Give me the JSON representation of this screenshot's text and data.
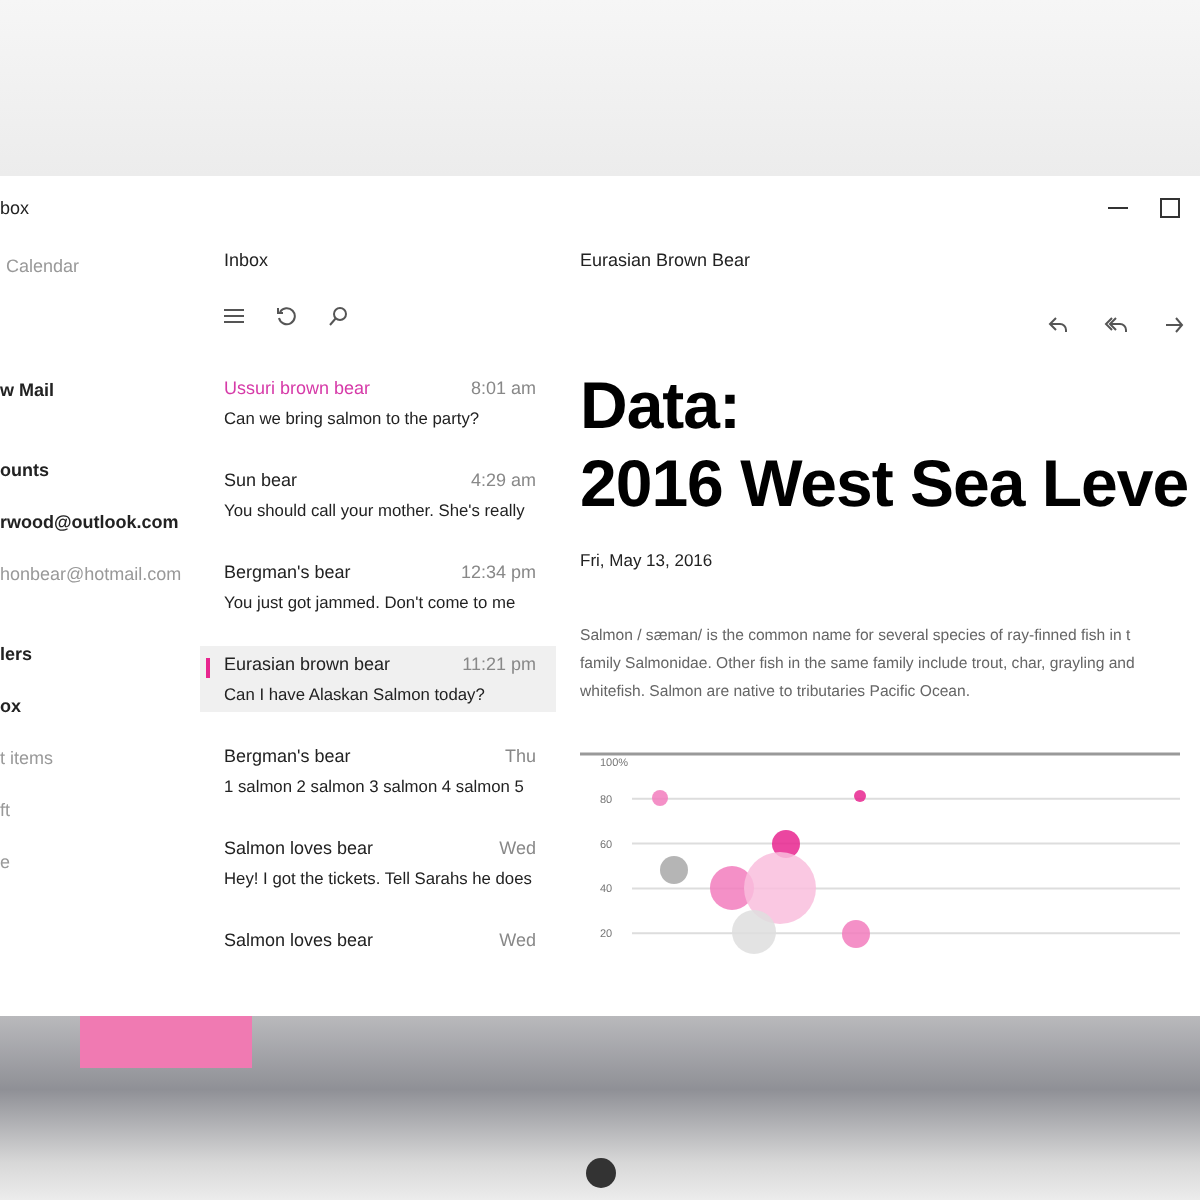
{
  "window": {
    "title": "box"
  },
  "sidebar": {
    "items": [
      {
        "label": "Calendar",
        "kind": "link"
      },
      {
        "label": "w Mail",
        "kind": "action"
      },
      {
        "label": "ounts",
        "kind": "heading"
      },
      {
        "label": "rwood@outlook.com",
        "kind": "account",
        "selected": true
      },
      {
        "label": "honbear@hotmail.com",
        "kind": "account",
        "selected": false
      },
      {
        "label": "lers",
        "kind": "heading"
      },
      {
        "label": "ox",
        "kind": "folder",
        "selected": true
      },
      {
        "label": "t items",
        "kind": "folder",
        "selected": false
      },
      {
        "label": "ft",
        "kind": "folder",
        "selected": false
      },
      {
        "label": "e",
        "kind": "folder",
        "selected": false
      }
    ]
  },
  "message_list": {
    "title": "Inbox",
    "messages": [
      {
        "sender": "Ussuri brown bear",
        "time": "8:01 am",
        "preview": "Can we bring salmon to the party?",
        "unread": true,
        "selected": false
      },
      {
        "sender": "Sun bear",
        "time": "4:29 am",
        "preview": "You should call your mother. She's really",
        "unread": false,
        "selected": false
      },
      {
        "sender": "Bergman's bear",
        "time": "12:34 pm",
        "preview": "You just got jammed. Don't come to me",
        "unread": false,
        "selected": false
      },
      {
        "sender": "Eurasian brown bear",
        "time": "11:21 pm",
        "preview": "Can I have Alaskan Salmon today?",
        "unread": false,
        "selected": true
      },
      {
        "sender": "Bergman's bear",
        "time": "Thu",
        "preview": "1 salmon 2 salmon 3 salmon 4 salmon 5",
        "unread": false,
        "selected": false
      },
      {
        "sender": "Salmon loves bear",
        "time": "Wed",
        "preview": "Hey! I got the tickets. Tell Sarahs he does",
        "unread": false,
        "selected": false
      },
      {
        "sender": "Salmon loves bear",
        "time": "Wed",
        "unread": false,
        "selected": false
      }
    ]
  },
  "reading_pane": {
    "title": "Eurasian Brown Bear",
    "heading": "Data:\n2016 West Sea Leve",
    "date": "Fri, May 13, 2016",
    "body": "Salmon / sæman/ is the common name for several species of ray-finned fish in t\nfamily Salmonidae. Other fish in the same family include trout, char, grayling and\nwhitefish. Salmon are native to tributaries Pacific Ocean.",
    "chart": {
      "axis_labels": [
        "100%",
        "80",
        "60",
        "40",
        "20"
      ]
    }
  }
}
